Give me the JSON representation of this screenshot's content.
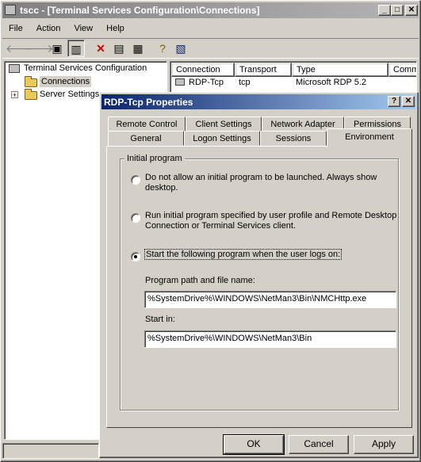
{
  "main_window": {
    "title": "tscc - [Terminal Services Configuration\\Connections]",
    "menu": [
      "File",
      "Action",
      "View",
      "Help"
    ],
    "tree": {
      "root": "Terminal Services Configuration",
      "items": [
        "Connections",
        "Server Settings"
      ]
    },
    "list": {
      "columns": [
        "Connection",
        "Transport",
        "Type",
        "Comme"
      ],
      "rows": [
        {
          "connection": "RDP-Tcp",
          "transport": "tcp",
          "type": "Microsoft RDP 5.2",
          "comment": ""
        }
      ]
    }
  },
  "dialog": {
    "title": "RDP-Tcp Properties",
    "tabs_back": [
      "Remote Control",
      "Client Settings",
      "Network Adapter",
      "Permissions"
    ],
    "tabs_front": [
      "General",
      "Logon Settings",
      "Sessions",
      "Environment"
    ],
    "active_tab": "Environment",
    "group_label": "Initial program",
    "option1": "Do not allow an initial program to be launched. Always show desktop.",
    "option2": "Run initial program specified by user profile and Remote Desktop Connection or Terminal Services client.",
    "option3": "Start the following program when the user logs on:",
    "selected_option": 3,
    "program_label": "Program path and file name:",
    "program_value": "%SystemDrive%\\WINDOWS\\NetMan3\\Bin\\NMCHttp.exe",
    "startin_label": "Start in:",
    "startin_value": "%SystemDrive%\\WINDOWS\\NetMan3\\Bin",
    "buttons": {
      "ok": "OK",
      "cancel": "Cancel",
      "apply": "Apply"
    }
  }
}
